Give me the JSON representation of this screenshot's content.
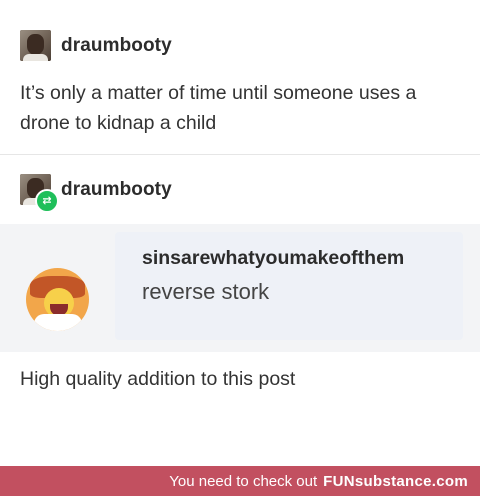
{
  "post1": {
    "username": "draumbooty",
    "body": "It’s only a matter of time until someone uses a drone to kidnap a child"
  },
  "post2": {
    "username": "draumbooty",
    "reblog_badge_icon": "reblog-icon",
    "quote": {
      "username": "sinsarewhatyoumakeofthem",
      "text": "reverse stork"
    },
    "body": "High quality addition to this post"
  },
  "footer": {
    "text": "You need to check out",
    "brand": "FUNsubstance.com",
    "background": "#c25060"
  },
  "colors": {
    "reblog_badge": "#1fbf5a",
    "quote_bg": "#eef1f7"
  }
}
